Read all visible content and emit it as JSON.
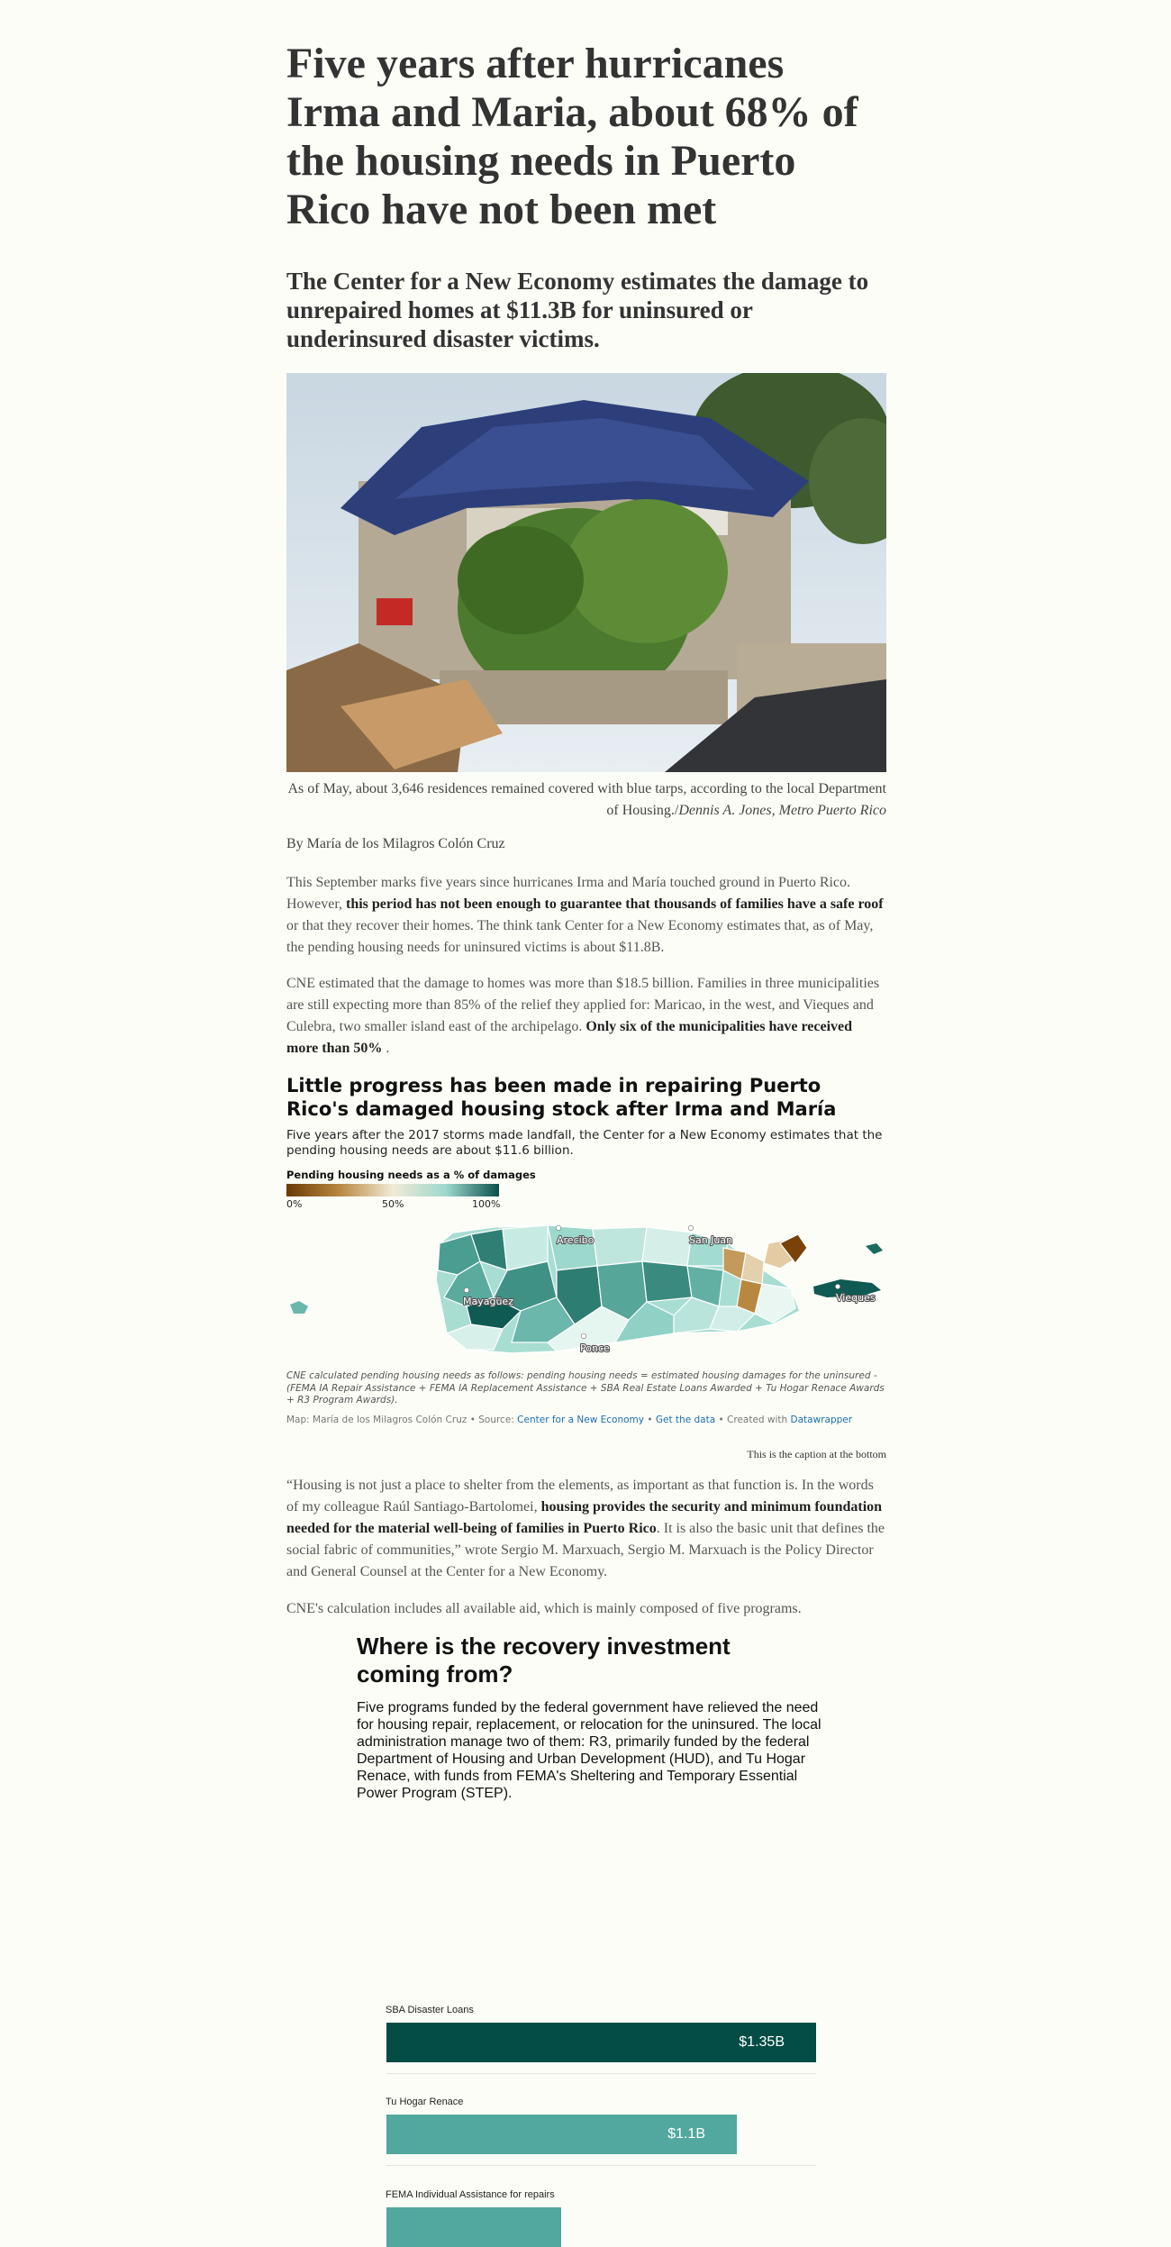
{
  "article": {
    "headline": "Five years after hurricanes Irma and Maria, about 68% of the housing needs in Puerto Rico have not been met",
    "dek": "The Center for a New Economy estimates the damage to unrepaired homes at $11.3B for uninsured or underinsured disaster victims.",
    "photo_caption": "As of May, about 3,646 residences remained covered with blue tarps, according to the local Department of Housing./",
    "photo_credit": "Dennis A. Jones, Metro Puerto Rico",
    "byline": "By María de los Milagros Colón Cruz",
    "p1_a": "This September marks five years since hurricanes Irma and María touched ground in Puerto Rico. However, ",
    "p1_b": "this period has not been enough to guarantee that thousands of families have a safe roof",
    "p1_c": " or that they recover their homes. The think tank Center for a New Economy estimates that, as of May, the pending housing needs for uninsured victims is about $11.8B.",
    "p2_a": "CNE estimated that the damage to homes was more than $18.5 billion. Families in three municipalities are still expecting more than 85% of the relief they applied for: Maricao, in the west, and Vieques and Culebra, two smaller island east of the archipelago. ",
    "p2_b": "Only six of the municipalities have received more than 50%",
    "p2_c": " .",
    "p3_a": "“Housing is not just a place to shelter from the elements, as important as that function is. In the words of my colleague Raúl Santiago-Bartolomei, ",
    "p3_b": "housing provides the security and minimum foundation needed for the material well-being of families in Puerto Rico",
    "p3_c": ". It is also the basic unit that defines the social fabric of communities,” wrote Sergio M. Marxuach, Sergio M. Marxuach is the Policy Director and General Counsel at the Center for a New Economy.",
    "p4": "CNE's calculation includes all available aid, which is mainly composed of five programs."
  },
  "map": {
    "title": "Little progress has been made in repairing Puerto Rico's damaged housing stock after Irma and María",
    "description": "Five years after the 2017 storms made landfall, the Center for a New Economy estimates that the pending housing needs are about $11.6 billion.",
    "legend_title": "Pending housing needs as a % of damages",
    "legend_ticks": [
      "0%",
      "50%",
      "100%"
    ],
    "legend_colors": [
      "#6b3a06",
      "#b98840",
      "#f2ead7",
      "#9dd8cd",
      "#0b4f4a"
    ],
    "cities": [
      "Arecibo",
      "San Juan",
      "Mayagüez",
      "Ponce",
      "Vieques"
    ],
    "note": "CNE calculated pending housing needs as follows: pending housing needs = estimated housing damages for the uninsured - (FEMA IA Repair Assistance + FEMA IA Replacement Assistance + SBA Real Estate Loans Awarded + Tu Hogar Renace Awards + R3 Program Awards).",
    "source_prefix": "Map: María de los Milagros Colón Cruz • Source: ",
    "source_link": "Center for a New Economy",
    "sep1": " • ",
    "data_link": "Get the data",
    "created_with": " • Created with ",
    "tool_link": "Datawrapper",
    "bottom_caption": "This is the caption at the bottom"
  },
  "investment": {
    "title": "Where is the recovery investment coming from?",
    "description": "Five programs funded by the federal government have relieved the need for housing repair, replacement, or relocation for the uninsured. The local administration manage two of them: R3, primarily funded by the federal Department of Housing and Urban Development (HUD), and Tu Hogar Renace, with funds from FEMA's Sheltering and Temporary Essential Power Program (STEP)."
  },
  "chart_data": {
    "type": "bar",
    "categories": [
      "SBA Disaster Loans",
      "Tu Hogar Renace",
      "FEMA Individual Assistance for repairs"
    ],
    "values": [
      1.35,
      1.1,
      0.55
    ],
    "value_labels": [
      "$1.35B",
      "$1.1B",
      ""
    ],
    "colors": [
      "#034d46",
      "#52a89e",
      "#52a89e"
    ],
    "xlim": [
      0,
      1.35
    ]
  }
}
